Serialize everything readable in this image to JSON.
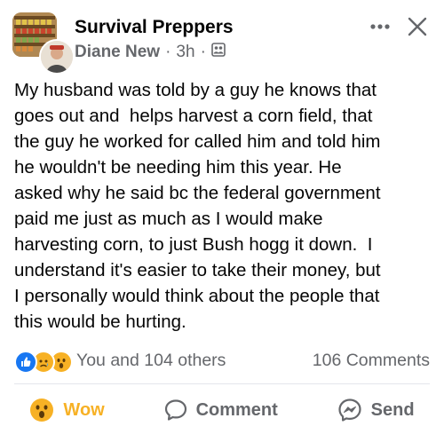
{
  "header": {
    "group_name": "Survival Preppers",
    "author": "Diane New",
    "separator": "·",
    "time": "3h",
    "privacy_icon": "group-members-icon",
    "more_icon": "more-dots-icon",
    "close_icon": "close-icon"
  },
  "post": {
    "text": "My husband was told by a guy he knows that\ngoes out and  helps harvest a corn field, that\nthe guy he worked for called him and told him\nhe wouldn't be needing him this year. He\nasked why he said bc the federal government\npaid me just as much as I would make\nharvesting corn, to just Bush hogg it down.  I\nunderstand it's easier to take their money, but\nI personally would think about the people that\nthis would be hurting."
  },
  "reactions": {
    "icons": [
      "like-icon",
      "sad-icon",
      "wow-icon"
    ],
    "summary": "You and 104 others",
    "comments": "106 Comments"
  },
  "actions": {
    "wow_label": "Wow",
    "comment_label": "Comment",
    "send_label": "Send"
  },
  "colors": {
    "like_blue": "#1877f2",
    "wow_yellow": "#f7b125",
    "secondary_text": "#65676b"
  }
}
